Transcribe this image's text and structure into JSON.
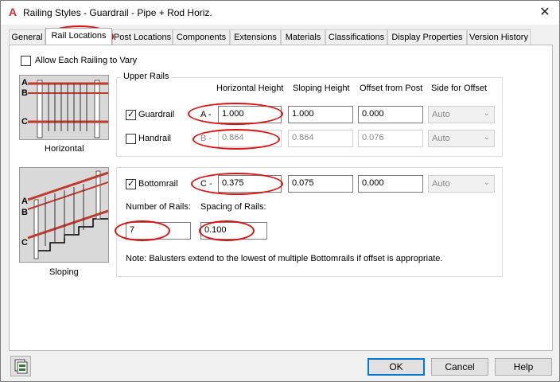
{
  "window": {
    "title": "Railing Styles - Guardrail - Pipe + Rod Horiz.",
    "app_icon": "A",
    "close_glyph": "✕"
  },
  "tabs": [
    {
      "label": "General"
    },
    {
      "label": "Rail Locations",
      "active": true
    },
    {
      "label": "Post Locations"
    },
    {
      "label": "Components"
    },
    {
      "label": "Extensions"
    },
    {
      "label": "Materials"
    },
    {
      "label": "Classifications"
    },
    {
      "label": "Display Properties"
    },
    {
      "label": "Version History"
    }
  ],
  "allow_vary": {
    "label": "Allow Each Railing to Vary",
    "checked": false
  },
  "horizontal_caption": "Horizontal",
  "sloping_caption": "Sloping",
  "illustration_letters": {
    "a": "A",
    "b": "B",
    "c": "C"
  },
  "upper_rails": {
    "group_label": "Upper Rails",
    "columns": {
      "horizontal_height": "Horizontal Height",
      "sloping_height": "Sloping Height",
      "offset_from_post": "Offset from Post",
      "side_for_offset": "Side for Offset"
    },
    "guardrail": {
      "label": "Guardrail",
      "checked": true,
      "prefix": "A -",
      "horizontal_height": "1.000",
      "sloping_height": "1.000",
      "offset": "0.000",
      "side": "Auto"
    },
    "handrail": {
      "label": "Handrail",
      "checked": false,
      "prefix": "B -",
      "horizontal_height": "0.864",
      "sloping_height": "0.864",
      "offset": "0.076",
      "side": "Auto"
    }
  },
  "bottomrail": {
    "label": "Bottomrail",
    "checked": true,
    "prefix": "C -",
    "horizontal_height": "0.375",
    "sloping_height": "0.075",
    "offset": "0.000",
    "side": "Auto",
    "number_label": "Number of Rails:",
    "number_value": "7",
    "spacing_label": "Spacing of Rails:",
    "spacing_value": "0.100",
    "note": "Note: Balusters extend to the lowest of multiple Bottomrails if offset is appropriate."
  },
  "buttons": {
    "ok": "OK",
    "cancel": "Cancel",
    "help": "Help"
  },
  "colors": {
    "highlight": "#e01010",
    "rail": "#c0392b",
    "accent": "#0078d7"
  }
}
